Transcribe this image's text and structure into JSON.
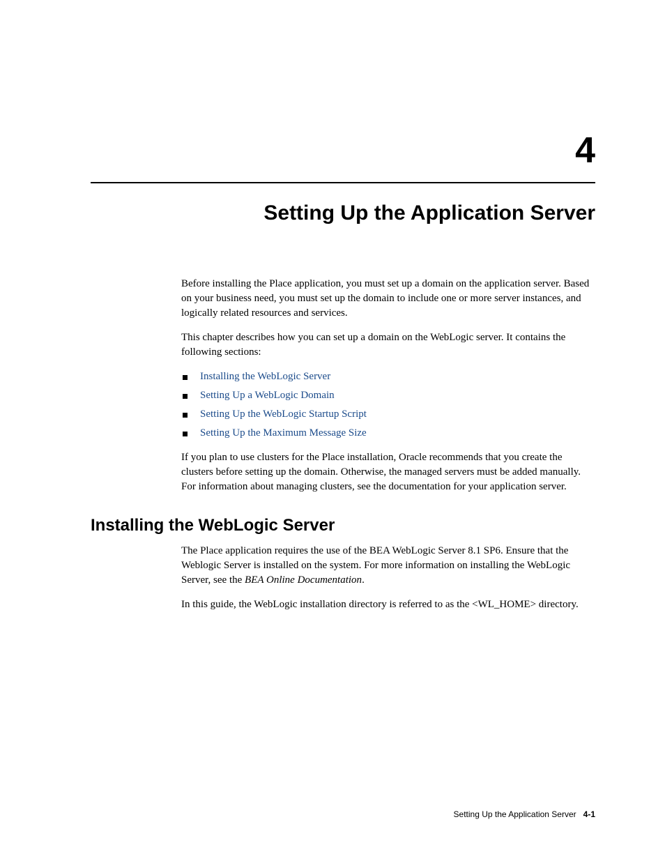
{
  "chapter": {
    "number": "4",
    "title": "Setting Up the Application Server"
  },
  "intro": {
    "p1": "Before installing the Place application, you must set up a domain on the application server. Based on your business need, you must set up the domain to include one or more server instances, and logically related resources and services.",
    "p2": "This chapter describes how you can set up a domain on the WebLogic server. It contains the following sections:"
  },
  "toc": [
    "Installing the WebLogic Server",
    "Setting Up a WebLogic Domain",
    "Setting Up the WebLogic Startup Script",
    "Setting Up the Maximum Message Size"
  ],
  "after_toc": "If you plan to use clusters for the Place installation, Oracle recommends that you create the clusters before setting up the domain. Otherwise, the managed servers must be added manually. For information about managing clusters, see the documentation for your application server.",
  "section1": {
    "heading": "Installing the WebLogic Server",
    "p1_pre": "The Place application requires the use of the BEA WebLogic Server 8.1 SP6. Ensure that the Weblogic Server is installed on the system. For more information on installing the WebLogic Server, see the ",
    "p1_italic": "BEA Online Documentation",
    "p1_post": ".",
    "p2": "In this guide, the WebLogic installation directory is referred to as the <WL_HOME> directory."
  },
  "footer": {
    "text": "Setting Up the Application Server",
    "page": "4-1"
  }
}
